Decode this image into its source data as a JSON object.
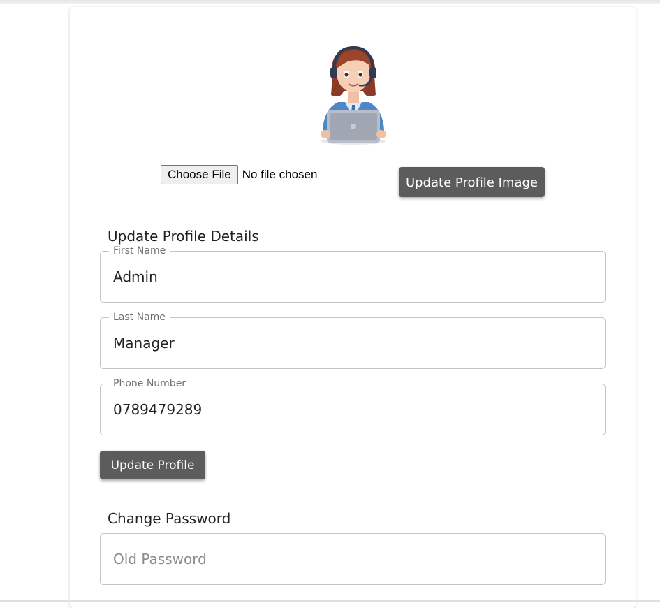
{
  "profile_image": {
    "avatar_icon": "support-agent-avatar",
    "file_input": {
      "button_label": "Choose File",
      "status": "No file chosen"
    },
    "update_button_label": "Update Profile Image"
  },
  "profile_details": {
    "title": "Update Profile Details",
    "fields": [
      {
        "label": "First Name",
        "value": "Admin"
      },
      {
        "label": "Last Name",
        "value": "Manager"
      },
      {
        "label": "Phone Number",
        "value": "0789479289"
      }
    ],
    "submit_label": "Update Profile"
  },
  "change_password": {
    "title": "Change Password",
    "old_password_placeholder": "Old Password"
  },
  "colors": {
    "button_bg": "#5c5c5c",
    "border": "#c4c4c4"
  }
}
